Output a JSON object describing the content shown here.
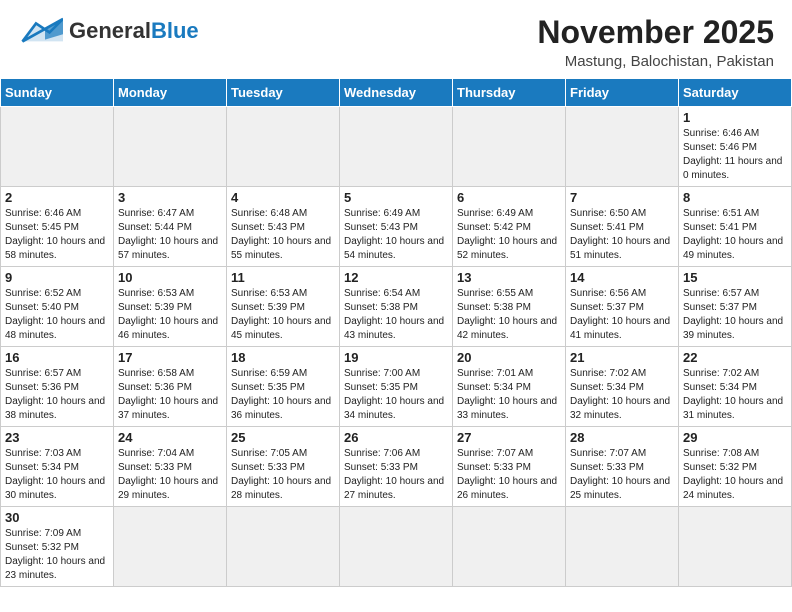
{
  "header": {
    "logo_general": "General",
    "logo_blue": "Blue",
    "month_title": "November 2025",
    "location": "Mastung, Balochistan, Pakistan"
  },
  "weekdays": [
    "Sunday",
    "Monday",
    "Tuesday",
    "Wednesday",
    "Thursday",
    "Friday",
    "Saturday"
  ],
  "days": {
    "1": {
      "sunrise": "6:46 AM",
      "sunset": "5:46 PM",
      "daylight": "11 hours and 0 minutes"
    },
    "2": {
      "sunrise": "6:46 AM",
      "sunset": "5:45 PM",
      "daylight": "10 hours and 58 minutes"
    },
    "3": {
      "sunrise": "6:47 AM",
      "sunset": "5:44 PM",
      "daylight": "10 hours and 57 minutes"
    },
    "4": {
      "sunrise": "6:48 AM",
      "sunset": "5:43 PM",
      "daylight": "10 hours and 55 minutes"
    },
    "5": {
      "sunrise": "6:49 AM",
      "sunset": "5:43 PM",
      "daylight": "10 hours and 54 minutes"
    },
    "6": {
      "sunrise": "6:49 AM",
      "sunset": "5:42 PM",
      "daylight": "10 hours and 52 minutes"
    },
    "7": {
      "sunrise": "6:50 AM",
      "sunset": "5:41 PM",
      "daylight": "10 hours and 51 minutes"
    },
    "8": {
      "sunrise": "6:51 AM",
      "sunset": "5:41 PM",
      "daylight": "10 hours and 49 minutes"
    },
    "9": {
      "sunrise": "6:52 AM",
      "sunset": "5:40 PM",
      "daylight": "10 hours and 48 minutes"
    },
    "10": {
      "sunrise": "6:53 AM",
      "sunset": "5:39 PM",
      "daylight": "10 hours and 46 minutes"
    },
    "11": {
      "sunrise": "6:53 AM",
      "sunset": "5:39 PM",
      "daylight": "10 hours and 45 minutes"
    },
    "12": {
      "sunrise": "6:54 AM",
      "sunset": "5:38 PM",
      "daylight": "10 hours and 43 minutes"
    },
    "13": {
      "sunrise": "6:55 AM",
      "sunset": "5:38 PM",
      "daylight": "10 hours and 42 minutes"
    },
    "14": {
      "sunrise": "6:56 AM",
      "sunset": "5:37 PM",
      "daylight": "10 hours and 41 minutes"
    },
    "15": {
      "sunrise": "6:57 AM",
      "sunset": "5:37 PM",
      "daylight": "10 hours and 39 minutes"
    },
    "16": {
      "sunrise": "6:57 AM",
      "sunset": "5:36 PM",
      "daylight": "10 hours and 38 minutes"
    },
    "17": {
      "sunrise": "6:58 AM",
      "sunset": "5:36 PM",
      "daylight": "10 hours and 37 minutes"
    },
    "18": {
      "sunrise": "6:59 AM",
      "sunset": "5:35 PM",
      "daylight": "10 hours and 36 minutes"
    },
    "19": {
      "sunrise": "7:00 AM",
      "sunset": "5:35 PM",
      "daylight": "10 hours and 34 minutes"
    },
    "20": {
      "sunrise": "7:01 AM",
      "sunset": "5:34 PM",
      "daylight": "10 hours and 33 minutes"
    },
    "21": {
      "sunrise": "7:02 AM",
      "sunset": "5:34 PM",
      "daylight": "10 hours and 32 minutes"
    },
    "22": {
      "sunrise": "7:02 AM",
      "sunset": "5:34 PM",
      "daylight": "10 hours and 31 minutes"
    },
    "23": {
      "sunrise": "7:03 AM",
      "sunset": "5:34 PM",
      "daylight": "10 hours and 30 minutes"
    },
    "24": {
      "sunrise": "7:04 AM",
      "sunset": "5:33 PM",
      "daylight": "10 hours and 29 minutes"
    },
    "25": {
      "sunrise": "7:05 AM",
      "sunset": "5:33 PM",
      "daylight": "10 hours and 28 minutes"
    },
    "26": {
      "sunrise": "7:06 AM",
      "sunset": "5:33 PM",
      "daylight": "10 hours and 27 minutes"
    },
    "27": {
      "sunrise": "7:07 AM",
      "sunset": "5:33 PM",
      "daylight": "10 hours and 26 minutes"
    },
    "28": {
      "sunrise": "7:07 AM",
      "sunset": "5:33 PM",
      "daylight": "10 hours and 25 minutes"
    },
    "29": {
      "sunrise": "7:08 AM",
      "sunset": "5:32 PM",
      "daylight": "10 hours and 24 minutes"
    },
    "30": {
      "sunrise": "7:09 AM",
      "sunset": "5:32 PM",
      "daylight": "10 hours and 23 minutes"
    }
  },
  "labels": {
    "sunrise": "Sunrise:",
    "sunset": "Sunset:",
    "daylight": "Daylight:"
  }
}
